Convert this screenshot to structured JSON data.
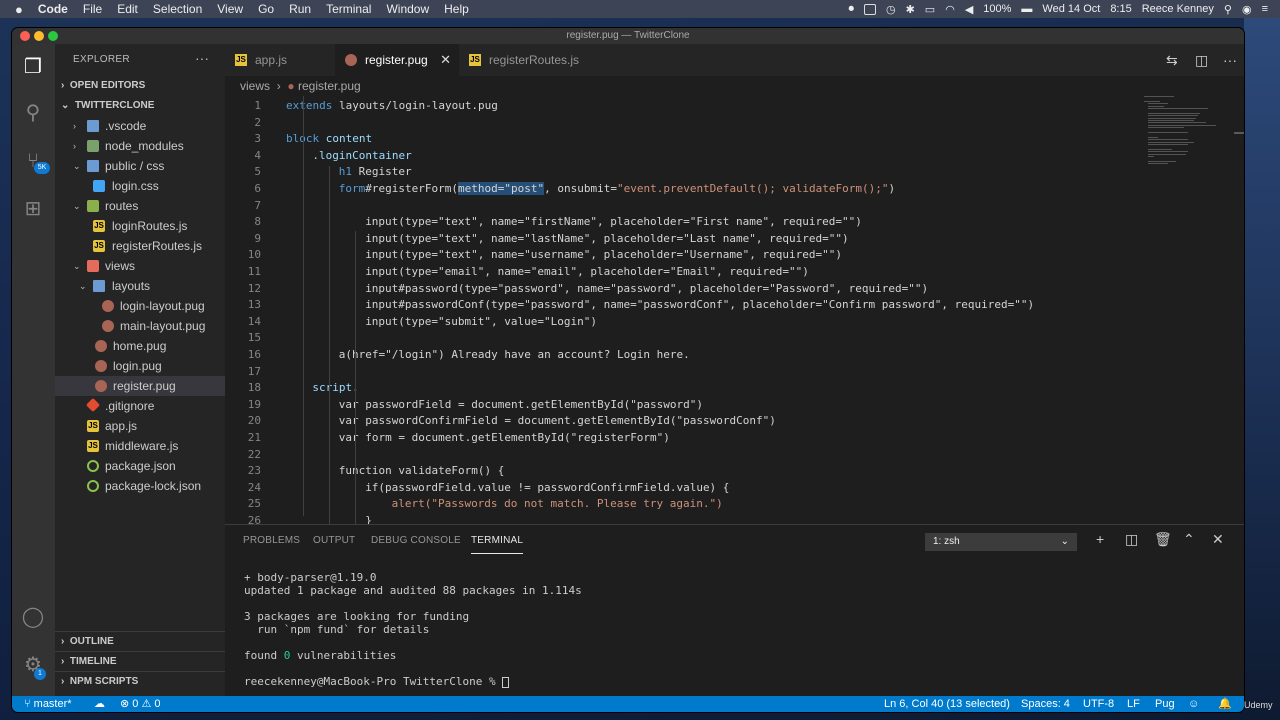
{
  "menubar": {
    "apple": "",
    "app": "Code",
    "items": [
      "File",
      "Edit",
      "Selection",
      "View",
      "Go",
      "Run",
      "Terminal",
      "Window",
      "Help"
    ],
    "battery": "100%",
    "date": "Wed 14 Oct",
    "time": "8:15",
    "user": "Reece Kenney"
  },
  "window": {
    "title": "register.pug — TwitterClone"
  },
  "activity": {
    "badge": "5K",
    "account_badge": "1"
  },
  "sidebar": {
    "title": "EXPLORER",
    "open_editors": "OPEN EDITORS",
    "project": "TWITTERCLONE",
    "tree": [
      ".vscode",
      "node_modules",
      "public / css",
      "login.css",
      "routes",
      "loginRoutes.js",
      "registerRoutes.js",
      "views",
      "layouts",
      "login-layout.pug",
      "main-layout.pug",
      "home.pug",
      "login.pug",
      "register.pug",
      ".gitignore",
      "app.js",
      "middleware.js",
      "package.json",
      "package-lock.json"
    ],
    "outline": "OUTLINE",
    "timeline": "TIMELINE",
    "npm": "NPM SCRIPTS"
  },
  "tabs": [
    "app.js",
    "register.pug",
    "registerRoutes.js"
  ],
  "breadcrumb": {
    "folder": "views",
    "file": "register.pug"
  },
  "code": {
    "l1a": "extends ",
    "l1b": "layouts/login-layout.pug",
    "l3a": "block ",
    "l3b": "content",
    "l4": ".loginContainer",
    "l5a": "h1 ",
    "l5b": "Register",
    "l6a": "form",
    "l6b": "#registerForm(",
    "l6c": "method=\"post\"",
    "l6d": ", onsubmit=",
    "l6e": "\"event.preventDefault(); validateForm();\"",
    "l6f": ")",
    "l8": "input(type=\"text\", name=\"firstName\", placeholder=\"First name\", required=\"\")",
    "l9": "input(type=\"text\", name=\"lastName\", placeholder=\"Last name\", required=\"\")",
    "l10": "input(type=\"text\", name=\"username\", placeholder=\"Username\", required=\"\")",
    "l11": "input(type=\"email\", name=\"email\", placeholder=\"Email\", required=\"\")",
    "l12": "input#password(type=\"password\", name=\"password\", placeholder=\"Password\", required=\"\")",
    "l13": "input#passwordConf(type=\"password\", name=\"passwordConf\", placeholder=\"Confirm password\", required=\"\")",
    "l14": "input(type=\"submit\", value=\"Login\")",
    "l16": "a(href=\"/login\") Already have an account? Login here.",
    "l18": "script.",
    "l19": "var passwordField = document.getElementById(\"password\")",
    "l20": "var passwordConfirmField = document.getElementById(\"passwordConf\")",
    "l21": "var form = document.getElementById(\"registerForm\")",
    "l23": "function validateForm() {",
    "l24": "if(passwordField.value != passwordConfirmField.value) {",
    "l25": "alert(\"Passwords do not match. Please try again.\")",
    "l26": "}"
  },
  "panel": {
    "tabs": [
      "PROBLEMS",
      "OUTPUT",
      "DEBUG CONSOLE",
      "TERMINAL"
    ],
    "terminal_select": "1: zsh",
    "t1": "+ body-parser@1.19.0",
    "t2": "updated 1 package and audited 88 packages in 1.114s",
    "t3": "3 packages are looking for funding",
    "t4": "  run `npm fund` for details",
    "t5a": "found ",
    "t5b": "0",
    "t5c": " vulnerabilities",
    "t6": "reecekenney@MacBook-Pro TwitterClone % "
  },
  "status": {
    "branch": "master*",
    "problems": "⊗ 0 ⚠ 0",
    "position": "Ln 6, Col 40 (13 selected)",
    "spaces": "Spaces: 4",
    "encoding": "UTF-8",
    "eol": "LF",
    "lang": "Pug"
  },
  "watermark": "Udemy"
}
